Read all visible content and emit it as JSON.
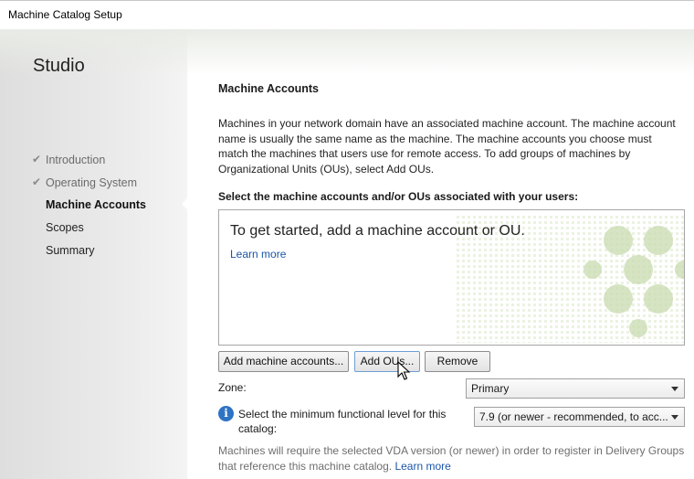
{
  "window": {
    "title": "Machine Catalog Setup"
  },
  "sidebar": {
    "brand": "Studio",
    "items": [
      {
        "label": "Introduction",
        "state": "done"
      },
      {
        "label": "Operating System",
        "state": "done"
      },
      {
        "label": "Machine Accounts",
        "state": "active"
      },
      {
        "label": "Scopes",
        "state": "pending"
      },
      {
        "label": "Summary",
        "state": "pending"
      }
    ]
  },
  "main": {
    "heading": "Machine Accounts",
    "intro": "Machines in your network domain have an associated machine account. The machine account name is usually the same name as the machine. The machine accounts you choose must match the machines that users use for remote access. To add groups of machines by Organizational Units (OUs), select Add OUs.",
    "list_label": "Select the machine accounts and/or OUs associated with your users:",
    "empty_message": "To get started, add a machine account or OU.",
    "learn_more": "Learn more",
    "buttons": {
      "add_machine_accounts": "Add machine accounts...",
      "add_ous": "Add OUs...",
      "remove": "Remove"
    },
    "zone": {
      "label": "Zone:",
      "value": "Primary"
    },
    "functional_level": {
      "label": "Select the minimum functional level for this catalog:",
      "value": "7.9 (or newer - recommended, to acc..."
    },
    "note": "Machines will require the selected VDA version (or newer) in order to register in Delivery Groups that reference this machine catalog.",
    "note_link": "Learn more"
  },
  "colors": {
    "link": "#1a55a8",
    "info_icon": "#2e73c4",
    "watermark": "#c9dcb0"
  },
  "icons": {
    "check": "check-icon",
    "info": "info-icon",
    "cursor": "mouse-pointer-icon"
  }
}
